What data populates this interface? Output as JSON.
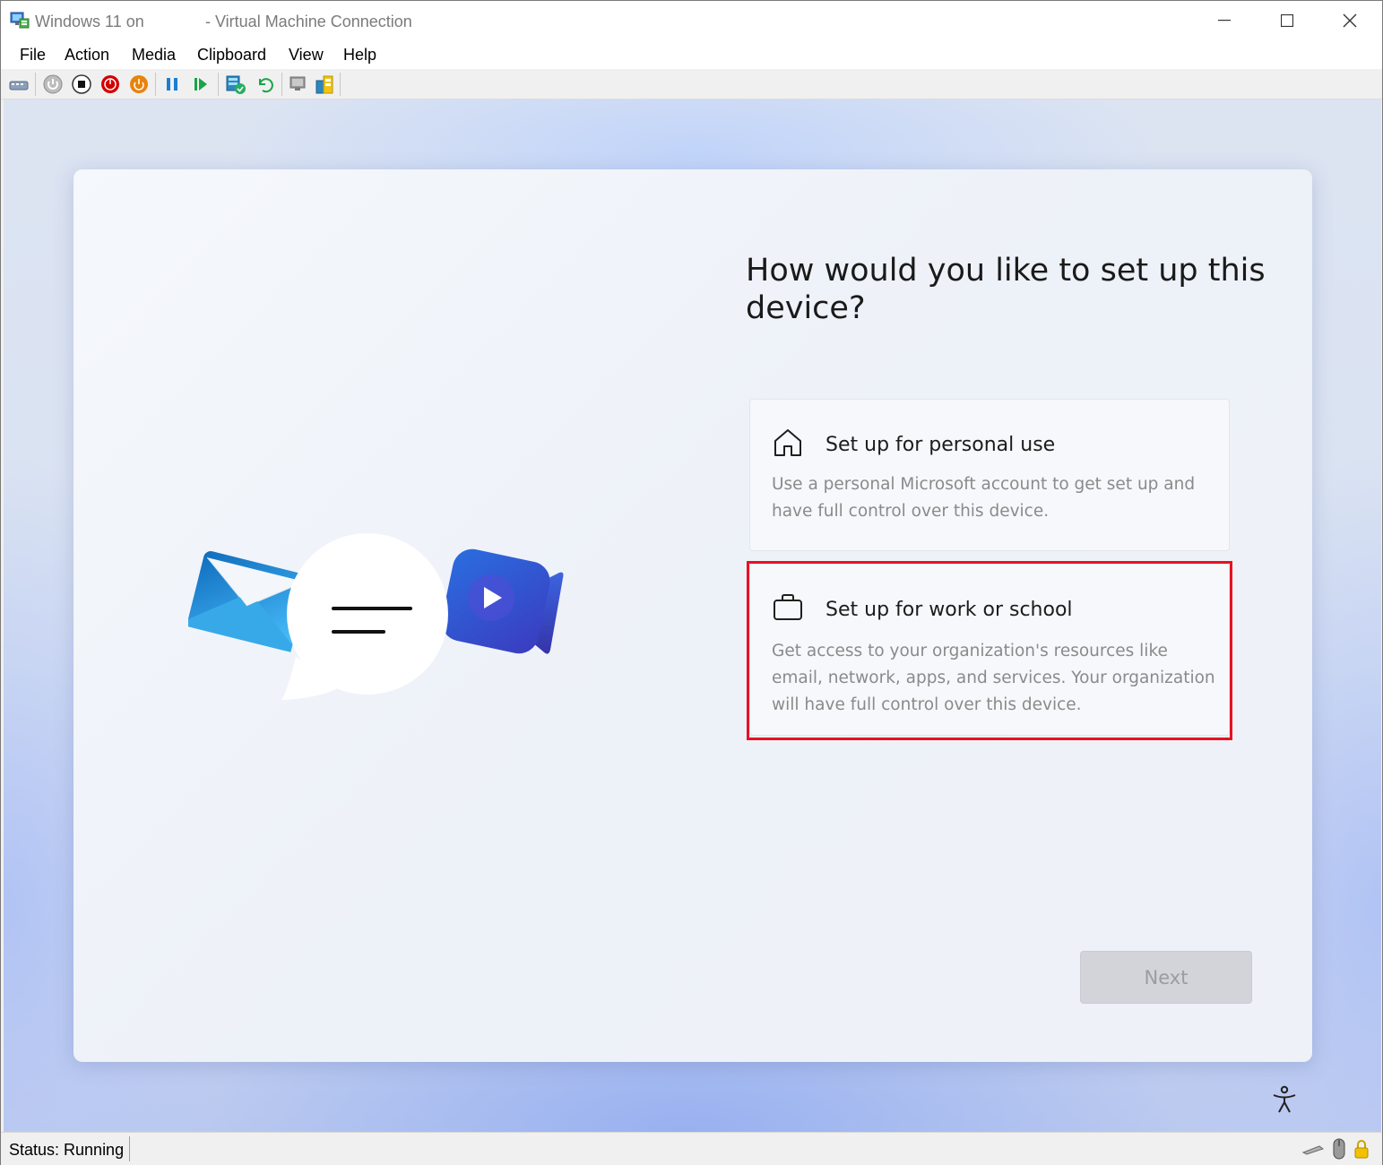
{
  "window": {
    "title_left": "Windows 11 on",
    "title_right": "- Virtual Machine Connection"
  },
  "menu": [
    "File",
    "Action",
    "Media",
    "Clipboard",
    "View",
    "Help"
  ],
  "toolbar": {
    "buttons": [
      "ctrl-alt-del-icon",
      "start-icon",
      "turn-off-icon",
      "shut-down-icon",
      "save-state-icon",
      "pause-icon",
      "resume-icon",
      "checkpoint-icon",
      "revert-icon",
      "enhanced-session-icon",
      "share-icon"
    ]
  },
  "oobe": {
    "heading": "How would you like to set up this device?",
    "options": [
      {
        "title": "Set up for personal use",
        "description": "Use a personal Microsoft account to get set up and have full control over this device.",
        "icon": "home-icon"
      },
      {
        "title": "Set up for work or school",
        "description": "Get access to your organization's resources like email, network, apps, and services. Your organization will have full control over this device.",
        "icon": "briefcase-icon"
      }
    ],
    "next_label": "Next",
    "highlight_color": "#e81123"
  },
  "status": {
    "text": "Status: Running"
  },
  "colors": {
    "accent_blue": "#0f6cbd",
    "status_red": "#d40000",
    "status_orange": "#e8830c"
  }
}
